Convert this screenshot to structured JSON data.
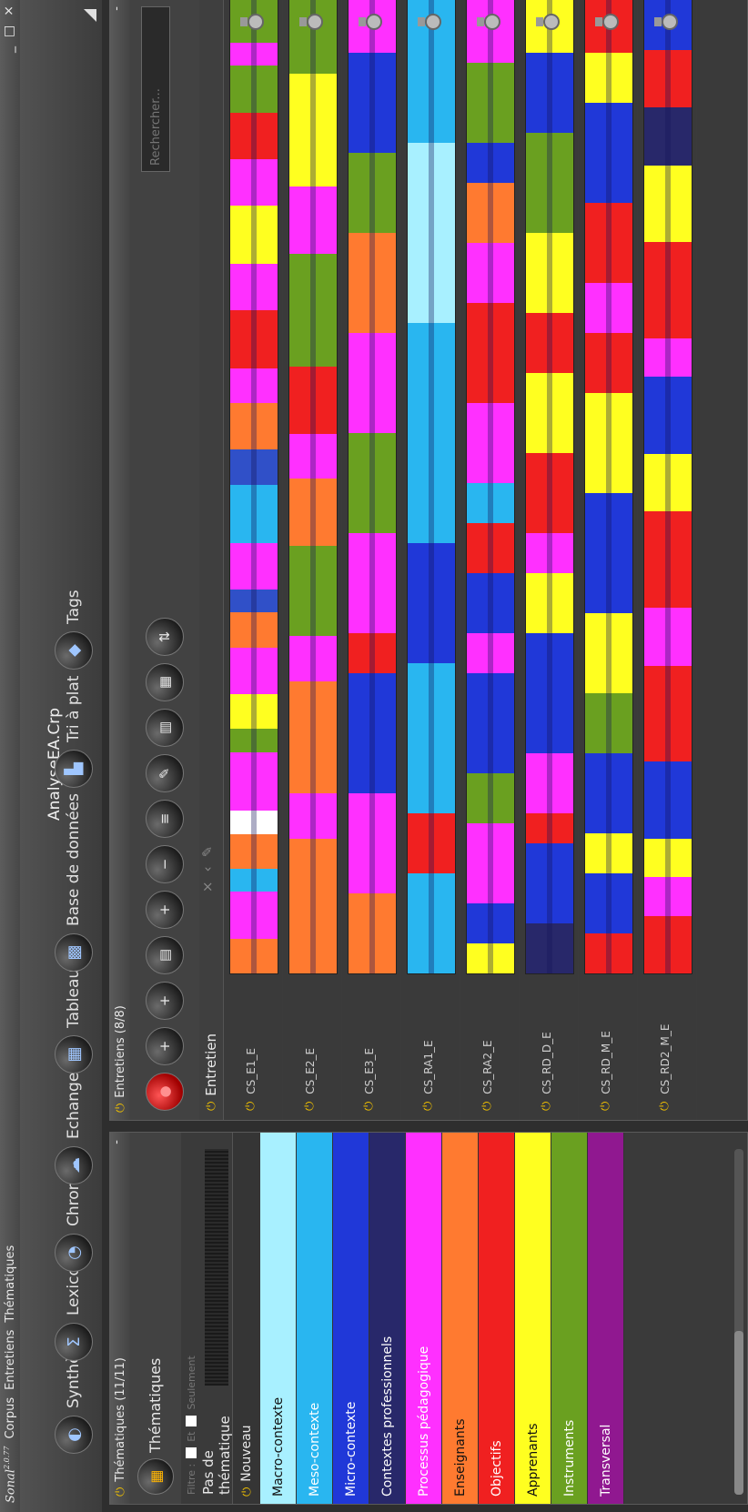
{
  "window": {
    "title": "AnalyseEA.Crp",
    "brand": "Sonal",
    "brand_version": "2.0.77",
    "controls": [
      "_",
      "□",
      "×"
    ]
  },
  "menu": [
    "Corpus",
    "Entretiens",
    "Thématiques"
  ],
  "toolbar": [
    {
      "label": "Synthèse",
      "icon": "synthesis-icon",
      "glyph": "◐"
    },
    {
      "label": "Lexico",
      "icon": "lexico-icon",
      "glyph": "Σ"
    },
    {
      "label": "Chrono",
      "icon": "chrono-icon",
      "glyph": "◔"
    },
    {
      "label": "Echanges",
      "icon": "exchanges-icon",
      "glyph": "☁"
    },
    {
      "label": "Tableau",
      "icon": "table-icon",
      "glyph": "▦"
    },
    {
      "label": "Base de données",
      "icon": "database-icon",
      "glyph": "▩"
    },
    {
      "label": "Tri à plat",
      "icon": "flat-sort-icon",
      "glyph": "▙"
    },
    {
      "label": "Tags",
      "icon": "tags-icon",
      "glyph": "◆"
    }
  ],
  "thematiques": {
    "header": "Thématiques (11/11)",
    "tool_label": "Thématiques",
    "filter_label": "Filtre :",
    "et_label": "Et",
    "seulement_label": "Seulement",
    "none_label": "Pas de thématique",
    "new_label": "Nouveau",
    "items": [
      {
        "label": "Macro-contexte",
        "color": "#a8f0ff"
      },
      {
        "label": "Meso-contexte",
        "color": "#29b6f0"
      },
      {
        "label": "Micro-contexte",
        "color": "#2038d8"
      },
      {
        "label": "Contextes professionnels",
        "color": "#28286a"
      },
      {
        "label": "Processus pédagogique",
        "color": "#ff30ff"
      },
      {
        "label": "Enseignants",
        "color": "#ff7a30"
      },
      {
        "label": "Objectifs",
        "color": "#f02020"
      },
      {
        "label": "Apprenants",
        "color": "#ffff20"
      },
      {
        "label": "Instruments",
        "color": "#6aa020"
      },
      {
        "label": "Transversal",
        "color": "#901890"
      }
    ]
  },
  "entretiens": {
    "header": "Entretiens (8/8)",
    "column_label": "Entretien",
    "search_placeholder": "Rechercher...",
    "tools": [
      {
        "icon": "record-icon",
        "glyph": "●"
      },
      {
        "icon": "add-interview-icon",
        "glyph": "+"
      },
      {
        "icon": "add-list-icon",
        "glyph": "+"
      },
      {
        "icon": "document-icon",
        "glyph": "▤"
      },
      {
        "icon": "zoom-in-icon",
        "glyph": "+"
      },
      {
        "icon": "zoom-out-icon",
        "glyph": "−"
      },
      {
        "icon": "list-icon",
        "glyph": "≡"
      },
      {
        "icon": "edit-icon",
        "glyph": "✎"
      },
      {
        "icon": "timeline-add-icon",
        "glyph": "▥"
      },
      {
        "icon": "bars-icon",
        "glyph": "▦"
      },
      {
        "icon": "sort-icon",
        "glyph": "⇅"
      }
    ],
    "rows": [
      {
        "name": "CS_E1_E",
        "segments": [
          [
            "#ff7a30",
            3
          ],
          [
            "#ff30ff",
            4
          ],
          [
            "#29b6f0",
            2
          ],
          [
            "#ff7a30",
            3
          ],
          [
            "#ffffff",
            2
          ],
          [
            "#ff30ff",
            5
          ],
          [
            "#6aa020",
            2
          ],
          [
            "#ffff20",
            3
          ],
          [
            "#ff30ff",
            4
          ],
          [
            "#ff7a30",
            3
          ],
          [
            "#3050c8",
            2
          ],
          [
            "#ff30ff",
            4
          ],
          [
            "#29b6f0",
            5
          ],
          [
            "#3050c8",
            3
          ],
          [
            "#ff7a30",
            4
          ],
          [
            "#ff30ff",
            3
          ],
          [
            "#f02020",
            5
          ],
          [
            "#ff30ff",
            4
          ],
          [
            "#ffff20",
            5
          ],
          [
            "#ff30ff",
            4
          ],
          [
            "#f02020",
            4
          ],
          [
            "#6aa020",
            4
          ],
          [
            "#ff30ff",
            2
          ],
          [
            "#6aa020",
            4
          ],
          [
            "#ff30ff",
            2
          ]
        ]
      },
      {
        "name": "CS_E2_E",
        "segments": [
          [
            "#ff7a30",
            12
          ],
          [
            "#ff30ff",
            4
          ],
          [
            "#ff7a30",
            10
          ],
          [
            "#ff30ff",
            4
          ],
          [
            "#6aa020",
            8
          ],
          [
            "#ff7a30",
            6
          ],
          [
            "#ff30ff",
            4
          ],
          [
            "#f02020",
            6
          ],
          [
            "#6aa020",
            10
          ],
          [
            "#ff30ff",
            6
          ],
          [
            "#ffff20",
            10
          ],
          [
            "#6aa020",
            9
          ]
        ]
      },
      {
        "name": "CS_E3_E",
        "segments": [
          [
            "#ff7a30",
            8
          ],
          [
            "#ff30ff",
            10
          ],
          [
            "#2038d8",
            12
          ],
          [
            "#f02020",
            4
          ],
          [
            "#ff30ff",
            10
          ],
          [
            "#6aa020",
            10
          ],
          [
            "#ff30ff",
            10
          ],
          [
            "#ff7a30",
            10
          ],
          [
            "#6aa020",
            8
          ],
          [
            "#2038d8",
            10
          ],
          [
            "#ff30ff",
            8
          ]
        ]
      },
      {
        "name": "CS_RA1_E",
        "segments": [
          [
            "#29b6f0",
            10
          ],
          [
            "#f02020",
            6
          ],
          [
            "#29b6f0",
            15
          ],
          [
            "#2038d8",
            12
          ],
          [
            "#29b6f0",
            22
          ],
          [
            "#a8f0ff",
            18
          ],
          [
            "#29b6f0",
            17
          ]
        ]
      },
      {
        "name": "CS_RA2_E",
        "segments": [
          [
            "#ffff20",
            3
          ],
          [
            "#2038d8",
            4
          ],
          [
            "#ff30ff",
            8
          ],
          [
            "#6aa020",
            5
          ],
          [
            "#2038d8",
            10
          ],
          [
            "#ff30ff",
            4
          ],
          [
            "#2038d8",
            6
          ],
          [
            "#f02020",
            5
          ],
          [
            "#29b6f0",
            4
          ],
          [
            "#ff30ff",
            8
          ],
          [
            "#f02020",
            10
          ],
          [
            "#ff30ff",
            6
          ],
          [
            "#ff7a30",
            6
          ],
          [
            "#2038d8",
            4
          ],
          [
            "#6aa020",
            8
          ],
          [
            "#ff30ff",
            9
          ]
        ]
      },
      {
        "name": "CS_RD_D_E",
        "segments": [
          [
            "#28286a",
            5
          ],
          [
            "#2038d8",
            8
          ],
          [
            "#f02020",
            3
          ],
          [
            "#ff30ff",
            6
          ],
          [
            "#2038d8",
            12
          ],
          [
            "#ffff20",
            6
          ],
          [
            "#ff30ff",
            4
          ],
          [
            "#f02020",
            8
          ],
          [
            "#ffff20",
            8
          ],
          [
            "#f02020",
            6
          ],
          [
            "#ffff20",
            8
          ],
          [
            "#6aa020",
            10
          ],
          [
            "#2038d8",
            8
          ],
          [
            "#ffff20",
            8
          ]
        ]
      },
      {
        "name": "CS_RD_M_E",
        "segments": [
          [
            "#f02020",
            4
          ],
          [
            "#2038d8",
            6
          ],
          [
            "#ffff20",
            4
          ],
          [
            "#2038d8",
            8
          ],
          [
            "#6aa020",
            6
          ],
          [
            "#ffff20",
            8
          ],
          [
            "#2038d8",
            12
          ],
          [
            "#ffff20",
            10
          ],
          [
            "#f02020",
            6
          ],
          [
            "#ff30ff",
            5
          ],
          [
            "#f02020",
            8
          ],
          [
            "#2038d8",
            10
          ],
          [
            "#ffff20",
            5
          ],
          [
            "#f02020",
            8
          ]
        ]
      },
      {
        "name": "CS_RD2_M_E",
        "segments": [
          [
            "#f02020",
            6
          ],
          [
            "#ff30ff",
            4
          ],
          [
            "#ffff20",
            4
          ],
          [
            "#2038d8",
            8
          ],
          [
            "#f02020",
            10
          ],
          [
            "#ff30ff",
            6
          ],
          [
            "#f02020",
            10
          ],
          [
            "#ffff20",
            6
          ],
          [
            "#2038d8",
            8
          ],
          [
            "#ff30ff",
            4
          ],
          [
            "#f02020",
            10
          ],
          [
            "#ffff20",
            8
          ],
          [
            "#28286a",
            6
          ],
          [
            "#f02020",
            6
          ],
          [
            "#2038d8",
            8
          ]
        ]
      }
    ]
  }
}
